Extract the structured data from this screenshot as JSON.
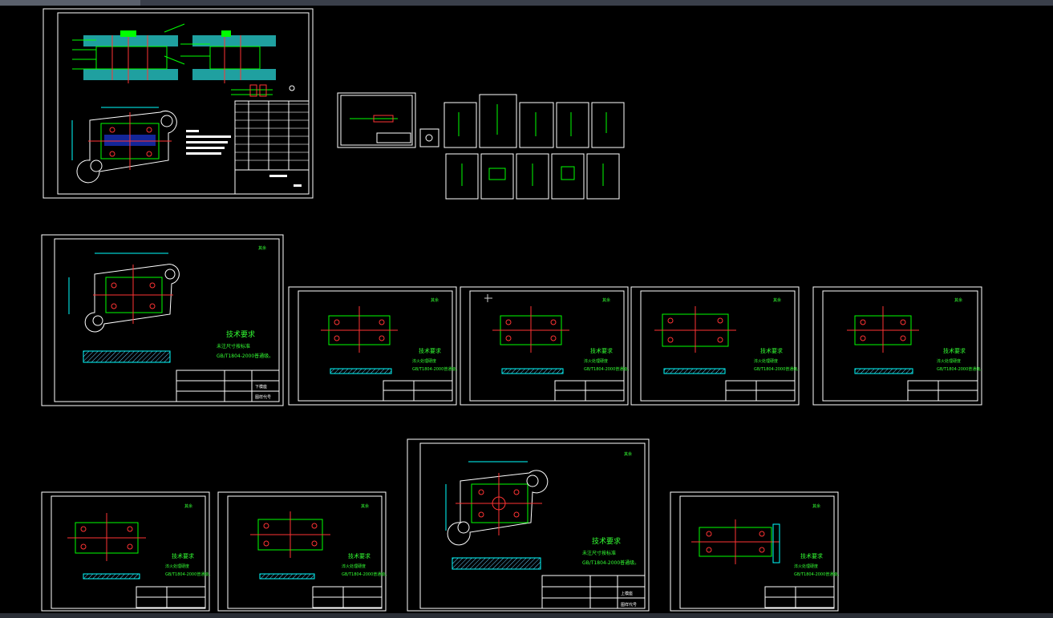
{
  "app": {
    "window": "CAD model space",
    "background": "#000000"
  },
  "colors": {
    "frame": "#ffffff",
    "part_outline": "#00ff00",
    "dimension": "#00ffff",
    "hole": "#ff3333",
    "centerline": "#ff3333",
    "section": "#66ccff",
    "title_text": "#ffffff"
  },
  "sheets": {
    "assembly": {
      "title_note": "",
      "stamp": ""
    },
    "lower_plate": {
      "tech_title": "技术要求",
      "tech_line1": "未注尺寸按标准",
      "tech_line2": "GB/T1804-2000普通级。",
      "roughness": "其余",
      "title_block_name": "下模座",
      "title_block_code": "图样代号"
    },
    "plate_2": {
      "tech_title": "技术要求",
      "tech_line1": "淬火处理硬度",
      "tech_line2": "GB/T1804-2000普通级。",
      "roughness": "其余"
    },
    "plate_3": {
      "tech_title": "技术要求",
      "tech_line1": "淬火处理硬度",
      "tech_line2": "GB/T1804-2000普通级。",
      "roughness": "其余"
    },
    "plate_4": {
      "tech_title": "技术要求",
      "tech_line1": "淬火处理硬度",
      "tech_line2": "GB/T1804-2000普通级。",
      "roughness": "其余"
    },
    "plate_5": {
      "tech_title": "技术要求",
      "tech_line1": "淬火处理硬度",
      "tech_line2": "GB/T1804-2000普通级。",
      "roughness": "其余"
    },
    "plate_6": {
      "tech_title": "技术要求",
      "tech_line1": "淬火处理硬度",
      "tech_line2": "GB/T1804-2000普通级。",
      "roughness": "其余"
    },
    "plate_7": {
      "tech_title": "技术要求",
      "tech_line1": "淬火处理硬度",
      "tech_line2": "GB/T1804-2000普通级。",
      "roughness": "其余"
    },
    "upper_plate": {
      "tech_title": "技术要求",
      "tech_line1": "未注尺寸按标准",
      "tech_line2": "GB/T1804-2000普通级。",
      "roughness": "其余",
      "title_block_name": "上模座",
      "title_block_code": "图样代号"
    },
    "plate_9": {
      "tech_title": "技术要求",
      "tech_line1": "淬火处理硬度",
      "tech_line2": "GB/T1804-2000普通级。",
      "roughness": "其余"
    }
  }
}
